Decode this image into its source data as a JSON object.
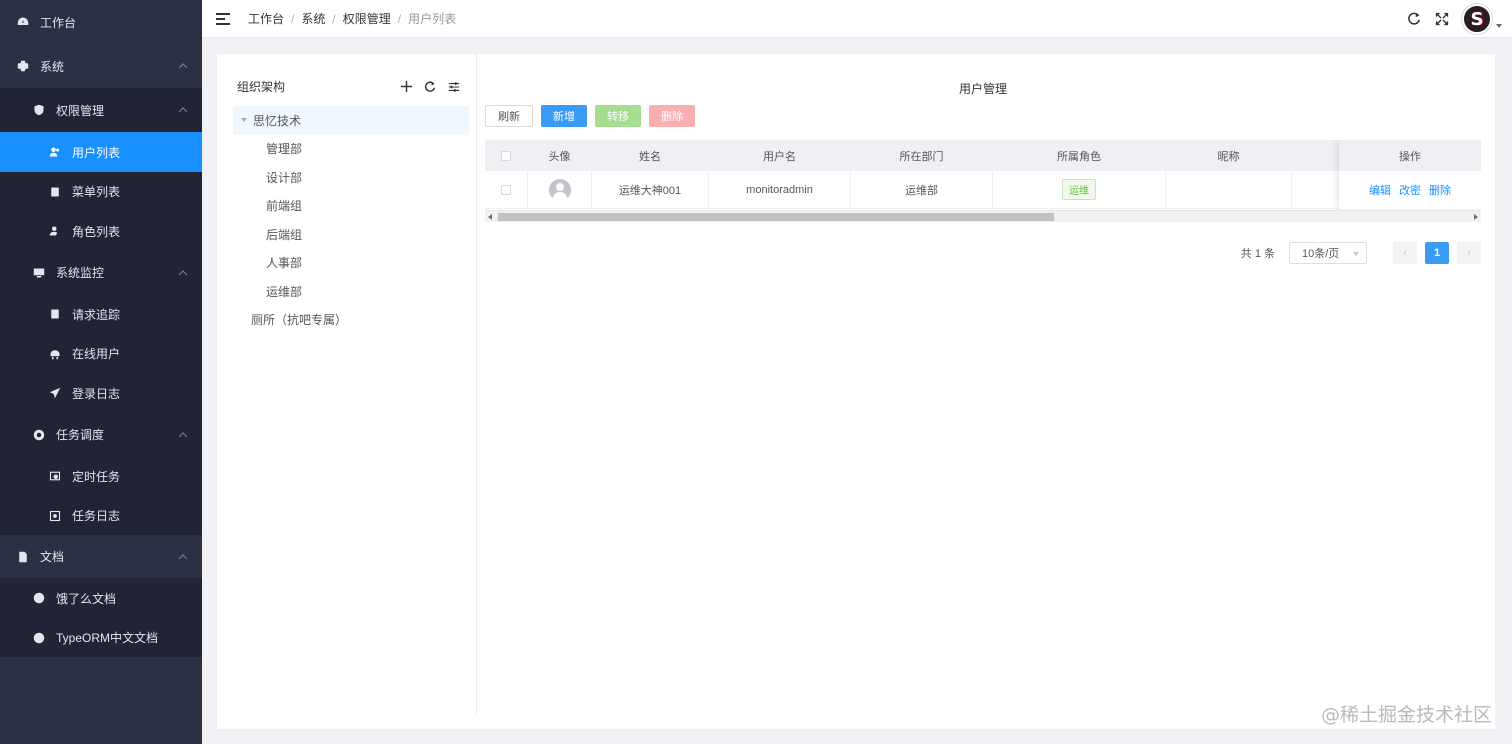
{
  "sidebar": {
    "items": [
      {
        "label": "工作台",
        "icon": "dashboard-icon"
      },
      {
        "label": "系统",
        "icon": "gear-icon"
      },
      {
        "label": "权限管理",
        "icon": "shield-icon"
      },
      {
        "label": "用户列表",
        "icon": "users-icon"
      },
      {
        "label": "菜单列表",
        "icon": "list-icon"
      },
      {
        "label": "角色列表",
        "icon": "user-role-icon"
      },
      {
        "label": "系统监控",
        "icon": "monitor-icon"
      },
      {
        "label": "请求追踪",
        "icon": "document-icon"
      },
      {
        "label": "在线用户",
        "icon": "online-icon"
      },
      {
        "label": "登录日志",
        "icon": "send-icon"
      },
      {
        "label": "任务调度",
        "icon": "compass-icon"
      },
      {
        "label": "定时任务",
        "icon": "clock-task-icon"
      },
      {
        "label": "任务日志",
        "icon": "log-icon"
      },
      {
        "label": "文档",
        "icon": "file-icon"
      },
      {
        "label": "饿了么文档",
        "icon": "globe-icon"
      },
      {
        "label": "TypeORM中文文档",
        "icon": "globe-icon"
      }
    ],
    "active": "用户列表",
    "colors": {
      "bg": "#2b3045",
      "active": "#1890ff",
      "submenu": "#202434"
    }
  },
  "header": {
    "breadcrumb": [
      "工作台",
      "系统",
      "权限管理",
      "用户列表"
    ],
    "separator": "/",
    "avatar_letter": "S"
  },
  "tree": {
    "title": "组织架构",
    "root": "思忆技术",
    "children": [
      "管理部",
      "设计部",
      "前端组",
      "后端组",
      "人事部",
      "运维部"
    ],
    "other": "厕所（抗吧专属）"
  },
  "main": {
    "title": "用户管理",
    "buttons": {
      "refresh": "刷新",
      "add": "新增",
      "move": "转移",
      "delete": "删除"
    },
    "columns": [
      "头像",
      "姓名",
      "用户名",
      "所在部门",
      "所属角色",
      "昵称",
      "操作"
    ],
    "rows": [
      {
        "name": "运维大神001",
        "username": "monitoradmin",
        "department": "运维部",
        "role": "运维",
        "nickname": "",
        "actions": [
          "编辑",
          "改密",
          "删除"
        ]
      }
    ],
    "pagination": {
      "total": "共 1 条",
      "page_size": "10条/页",
      "current": "1",
      "prev": "‹",
      "next": "›"
    }
  },
  "watermark": "@稀土掘金技术社区"
}
